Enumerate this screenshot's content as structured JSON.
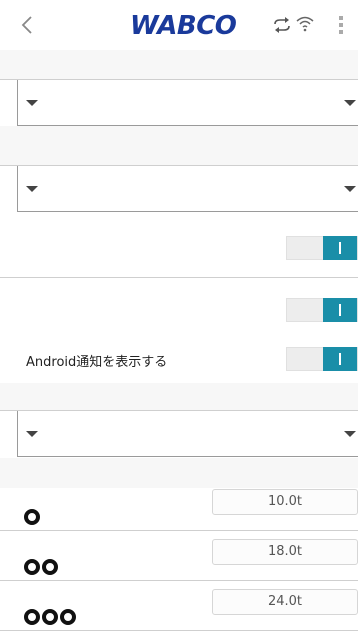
{
  "header": {
    "brand": "WABCO"
  },
  "settings": {
    "notify_label": "Android通知を表示する",
    "toggles": [
      {
        "on": true
      },
      {
        "on": true
      },
      {
        "on": true
      }
    ]
  },
  "axle_loads": [
    {
      "axles": 1,
      "value": "10.0t"
    },
    {
      "axles": 2,
      "value": "18.0t"
    },
    {
      "axles": 3,
      "value": "24.0t"
    }
  ],
  "icons": {
    "back": "chevron-left-icon",
    "sync": "sync-icon",
    "wifi": "wifi-icon",
    "menu": "kebab-menu-icon",
    "dropdown": "caret-down-icon",
    "axle": "axle-icon"
  },
  "colors": {
    "brand": "#1a3a9b",
    "toggle_on": "#1a8ea8"
  }
}
